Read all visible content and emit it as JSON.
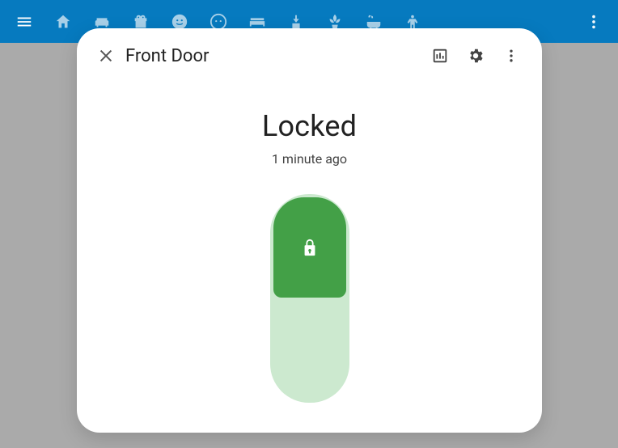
{
  "appbar": {
    "menu_name": "menu-icon",
    "icons": [
      "home-icon",
      "sofa-icon",
      "gift-icon",
      "face-happy-icon",
      "face-icon",
      "bed-icon",
      "appliance-icon",
      "plant-icon",
      "bathtub-icon",
      "child-icon"
    ],
    "more_name": "more-icon"
  },
  "dialog": {
    "title": "Front Door",
    "status": "Locked",
    "elapsed": "1 minute ago",
    "actions": {
      "close": "close",
      "history": "history",
      "settings": "settings",
      "more": "more"
    }
  },
  "colors": {
    "appbar": "#067abf",
    "thumb": "#43a047",
    "track": "#cce9cf"
  }
}
